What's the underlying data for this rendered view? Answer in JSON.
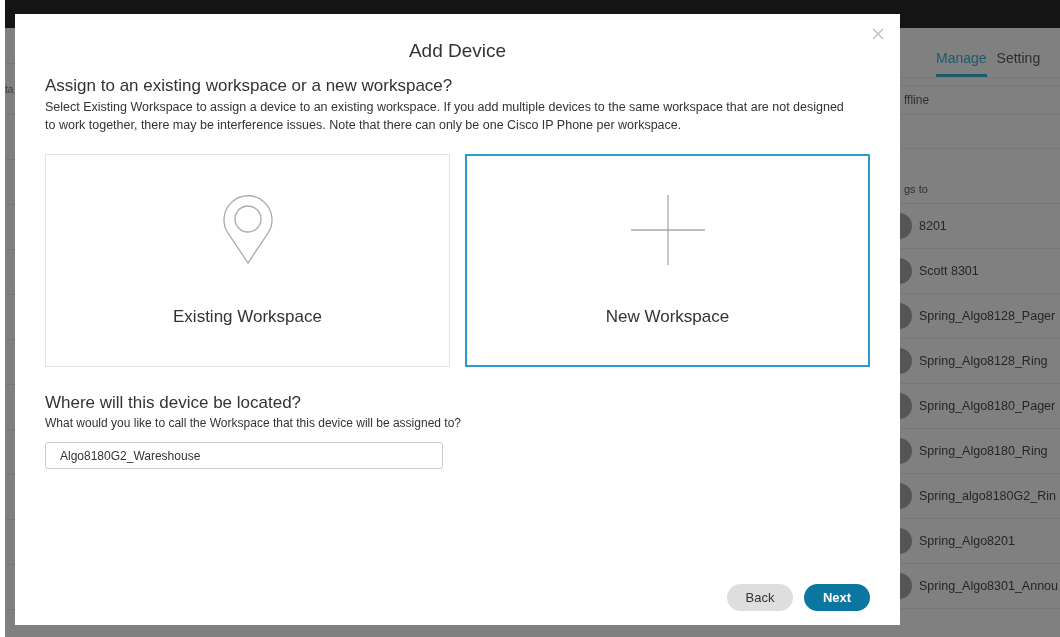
{
  "background": {
    "left_label": "ta",
    "tabs": [
      {
        "label": "Manage",
        "selected": true
      },
      {
        "label": "Setting",
        "selected": false
      }
    ],
    "status": "ffline",
    "column_heading": "gs to",
    "rows": [
      {
        "name": "8201"
      },
      {
        "name": "Scott 8301"
      },
      {
        "name": "Spring_Algo8128_Pager"
      },
      {
        "name": "Spring_Algo8128_Ring"
      },
      {
        "name": "Spring_Algo8180_Pager"
      },
      {
        "name": "Spring_Algo8180_Ring"
      },
      {
        "name": "Spring_algo8180G2_Rin"
      },
      {
        "name": "Spring_Algo8201"
      },
      {
        "name": "Spring_Algo8301_Annou"
      }
    ]
  },
  "dialog": {
    "title": "Add Device",
    "heading": "Assign to an existing workspace or a new workspace?",
    "description": "Select Existing Workspace to assign a device to an existing workspace. If you add multiple devices to the same workspace that are not designed to work together, there may be interference issues. Note that there can only be one Cisco IP Phone per workspace.",
    "options": [
      {
        "label": "Existing Workspace",
        "kind": "pin",
        "selected": false
      },
      {
        "label": "New Workspace",
        "kind": "plus",
        "selected": true
      }
    ],
    "location_heading": "Where will this device be located?",
    "location_hint": "What would you like to call the Workspace that this device will be assigned to?",
    "name_field": {
      "value": "Algo8180G2_Wareshouse"
    },
    "buttons": [
      {
        "label": "Back",
        "kind": "secondary"
      },
      {
        "label": "Next",
        "kind": "primary"
      }
    ]
  }
}
